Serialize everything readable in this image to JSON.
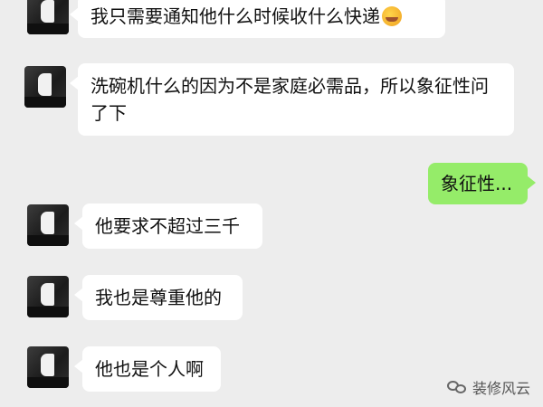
{
  "messages": [
    {
      "sender": "other",
      "text": "我只需要通知他什么时候收什么快递",
      "emoji": "laughing-crying-emoji"
    },
    {
      "sender": "other",
      "text": "洗碗机什么的因为不是家庭必需品，所以象征性问了下"
    },
    {
      "sender": "me",
      "text": "象征性..."
    },
    {
      "sender": "other",
      "text": "他要求不超过三千"
    },
    {
      "sender": "other",
      "text": "我也是尊重他的"
    },
    {
      "sender": "other",
      "text": "他也是个人啊"
    }
  ],
  "watermark": {
    "text": "装修风云",
    "icon": "wechat-icon"
  },
  "colors": {
    "background": "#ededed",
    "incoming_bubble": "#ffffff",
    "outgoing_bubble": "#95ec69"
  }
}
